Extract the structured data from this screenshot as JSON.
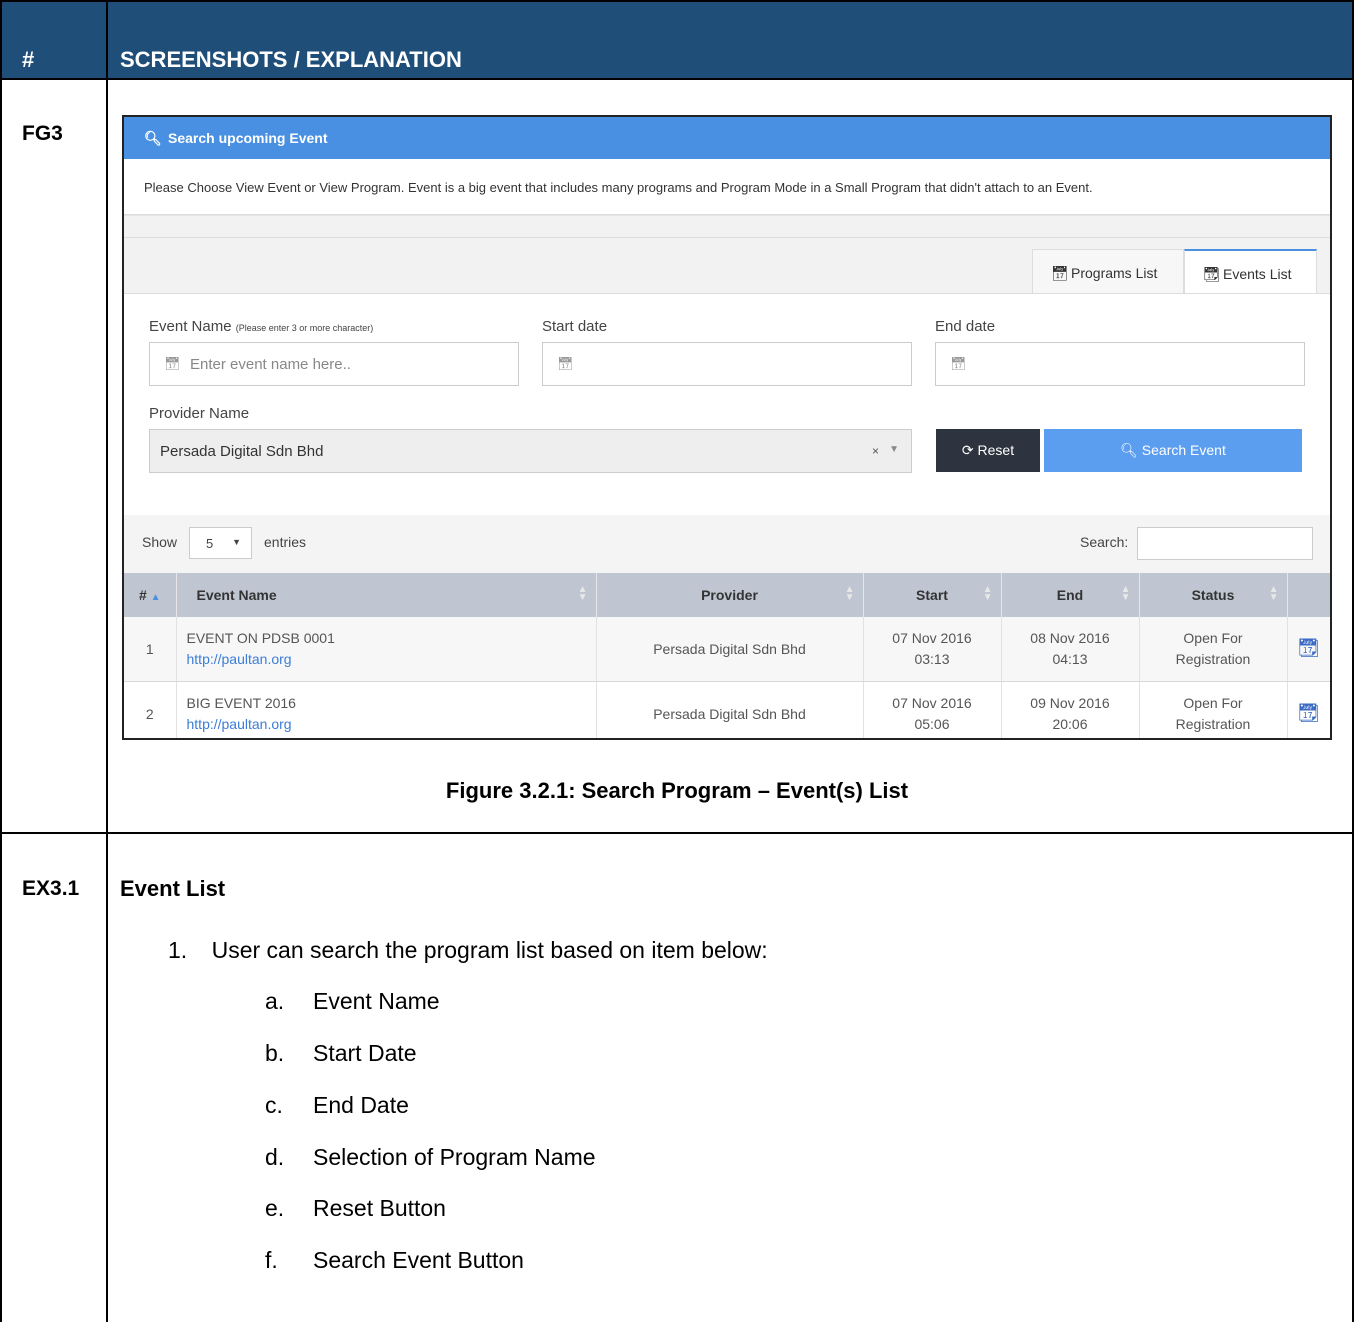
{
  "doc": {
    "header_num": "#",
    "header_title": "SCREENSHOTS / EXPLANATION",
    "row1_label": "FG3",
    "row2_label": "EX3.1",
    "caption": "Figure 3.2.1: Search Program – Event(s) List",
    "section_title": "Event List",
    "list_item_1_num": "1.",
    "list_item_1": "User can search the program list based on item below:",
    "sub_items": [
      {
        "letter": "a.",
        "text": "Event Name"
      },
      {
        "letter": "b.",
        "text": "Start Date"
      },
      {
        "letter": "c.",
        "text": "End Date"
      },
      {
        "letter": "d.",
        "text": "Selection of Program Name"
      },
      {
        "letter": "e.",
        "text": "Reset Button"
      },
      {
        "letter": "f.",
        "text": "Search Event Button"
      }
    ]
  },
  "panel": {
    "title": "Search upcoming Event",
    "description": "Please Choose View Event or View Program. Event is a big event that includes many programs and Program Mode in a Small Program that didn't attach to an Event.",
    "tabs": [
      {
        "label": "Programs List",
        "icon": "calendar-icon"
      },
      {
        "label": "Events List",
        "icon": "calendar-grid-icon",
        "active": true
      }
    ],
    "event_name_label": "Event Name",
    "event_name_hint": "(Please enter 3 or more character)",
    "event_name_placeholder": "Enter event name here..",
    "start_label": "Start date",
    "end_label": "End date",
    "provider_label": "Provider Name",
    "provider_value": "Persada Digital Sdn Bhd",
    "provider_clear": "×",
    "reset_label": "Reset",
    "search_label": "Search Event",
    "accent_color": "#4a90e2"
  },
  "table": {
    "show_label": "Show",
    "page_length": "5",
    "entries_label": "entries",
    "search_label": "Search:",
    "columns": [
      "#",
      "Event Name",
      "Provider",
      "Start",
      "End",
      "Status"
    ],
    "rows": [
      {
        "num": "1",
        "name": "EVENT ON PDSB 0001",
        "url": "http://paultan.org",
        "provider": "Persada Digital Sdn Bhd",
        "start_date": "07 Nov 2016",
        "start_time": "03:13",
        "end_date": "08 Nov 2016",
        "end_time": "04:13",
        "status_1": "Open For",
        "status_2": "Registration"
      },
      {
        "num": "2",
        "name": "BIG EVENT 2016",
        "url": "http://paultan.org",
        "provider": "Persada Digital Sdn Bhd",
        "start_date": "07 Nov 2016",
        "start_time": "05:06",
        "end_date": "09 Nov 2016",
        "end_time": "20:06",
        "status_1": "Open For",
        "status_2": "Registration"
      }
    ]
  }
}
